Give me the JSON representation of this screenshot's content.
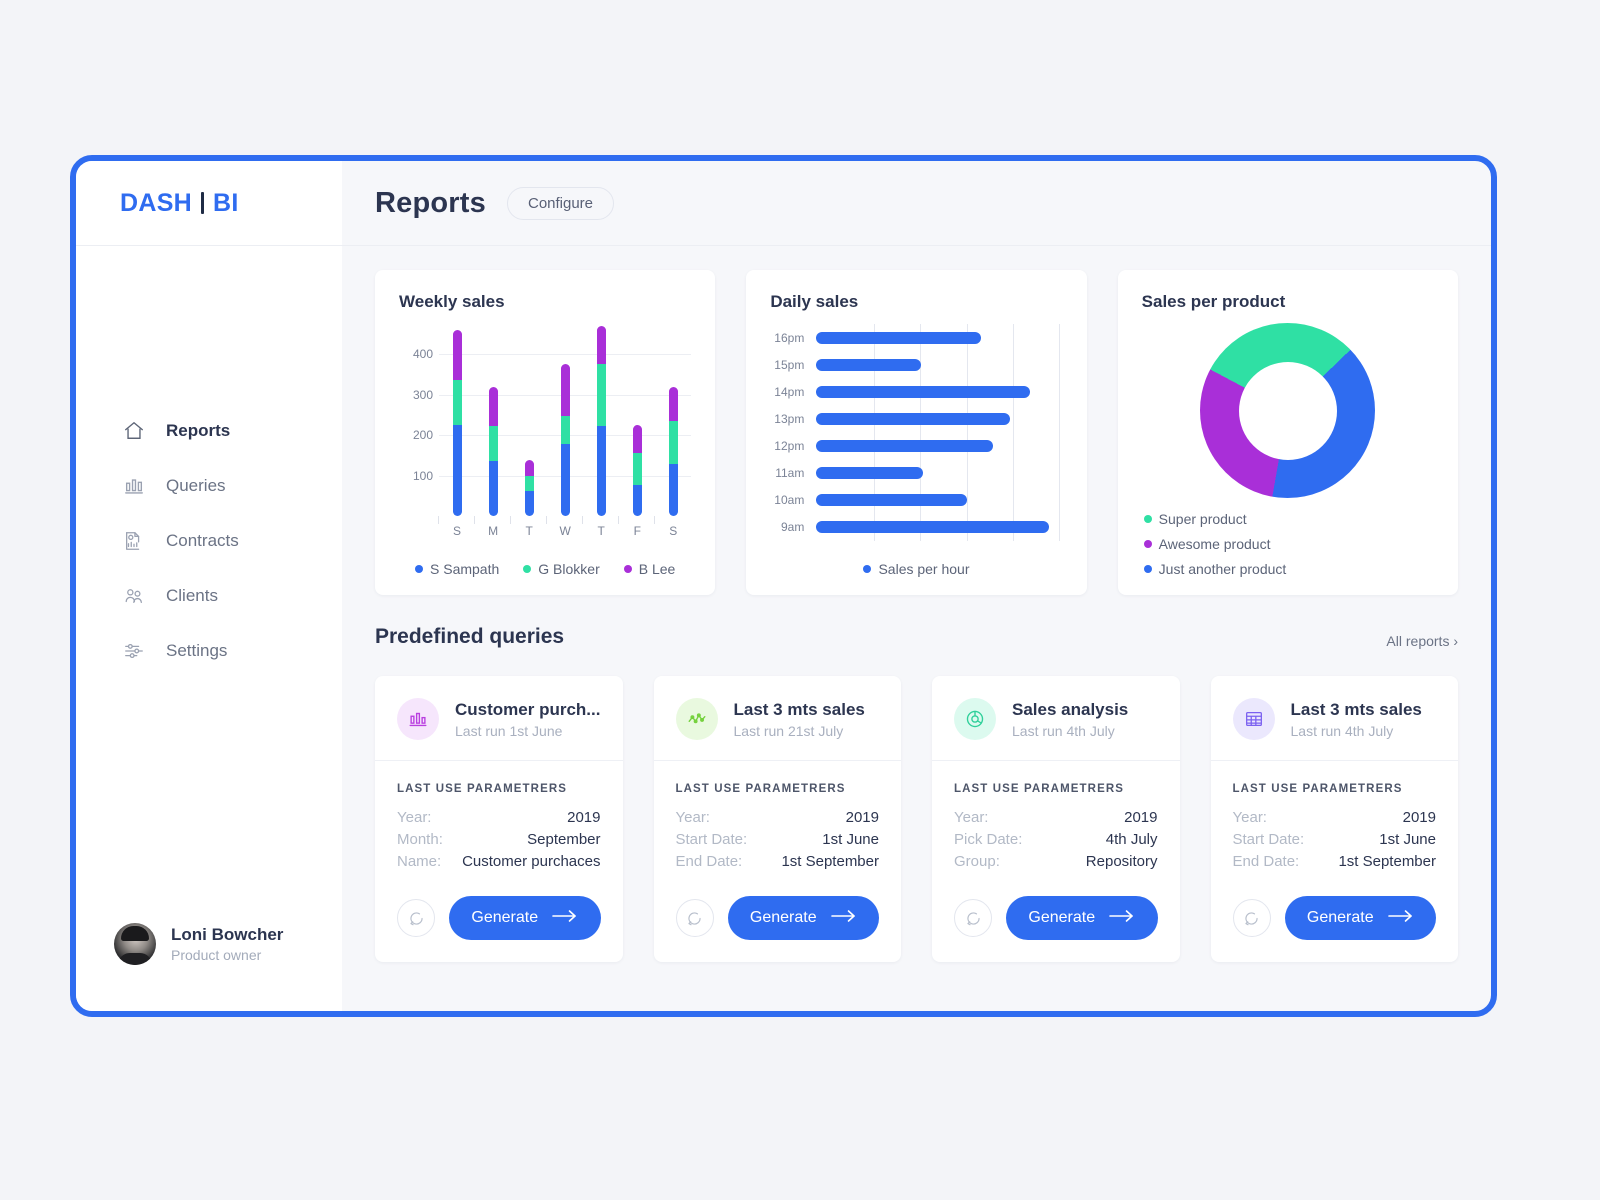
{
  "brand": {
    "part1": "DASH",
    "part2": "BI"
  },
  "sidebar": {
    "items": [
      {
        "label": "Reports",
        "icon": "home-icon",
        "active": true
      },
      {
        "label": "Queries",
        "icon": "bar-chart-icon",
        "active": false
      },
      {
        "label": "Contracts",
        "icon": "document-chart-icon",
        "active": false
      },
      {
        "label": "Clients",
        "icon": "users-icon",
        "active": false
      },
      {
        "label": "Settings",
        "icon": "sliders-icon",
        "active": false
      }
    ],
    "profile": {
      "name": "Loni Bowcher",
      "role": "Product owner"
    }
  },
  "header": {
    "title": "Reports",
    "configure_label": "Configure"
  },
  "colors": {
    "blue": "#2f6cf0",
    "green": "#2fe0a4",
    "purple": "#a92fd8",
    "text_dark": "#2c3550",
    "text_muted": "#7b8396"
  },
  "chart_data": [
    {
      "type": "bar",
      "title": "Weekly sales",
      "stacked": true,
      "categories": [
        "S",
        "M",
        "T",
        "W",
        "T",
        "F",
        "S"
      ],
      "series": [
        {
          "name": "S Sampath",
          "color": "#2f6cf0",
          "values": [
            225,
            135,
            62,
            178,
            227,
            76,
            129
          ]
        },
        {
          "name": "G Blokker",
          "color": "#2fe0a4",
          "values": [
            112,
            88,
            36,
            70,
            155,
            80,
            106
          ]
        },
        {
          "name": "B Lee",
          "color": "#a92fd8",
          "values": [
            123,
            96,
            41,
            128,
            95,
            70,
            84
          ]
        }
      ],
      "ylim": [
        0,
        470
      ],
      "yticks": [
        100,
        200,
        300,
        400
      ],
      "xlabel": "",
      "ylabel": "",
      "grid": true,
      "legend_position": "bottom"
    },
    {
      "type": "bar",
      "title": "Daily sales",
      "orientation": "horizontal",
      "categories": [
        "16pm",
        "15pm",
        "14pm",
        "13pm",
        "12pm",
        "11am",
        "10am",
        "9am"
      ],
      "series": [
        {
          "name": "Sales per hour",
          "color": "#2f6cf0",
          "values": [
            68,
            43,
            88,
            80,
            73,
            44,
            62,
            96
          ]
        }
      ],
      "xlim": [
        0,
        100
      ],
      "grid": true,
      "legend_position": "bottom"
    },
    {
      "type": "pie",
      "title": "Sales per product",
      "donut": true,
      "labels": [
        "Super product",
        "Awesome product",
        "Just another product"
      ],
      "values": [
        30,
        30,
        40
      ],
      "colors": [
        "#2fe0a4",
        "#a92fd8",
        "#2f6cf0"
      ],
      "legend_position": "bottom"
    }
  ],
  "queries_section": {
    "title": "Predefined queries",
    "all_reports_label": "All reports ›"
  },
  "query_cards": [
    {
      "name": "Customer purch...",
      "last_run": "Last run 1st June",
      "icon": "bar-chart-icon",
      "icon_color": "#b93fe0",
      "icon_bg": "#f6e6fc",
      "params_title": "LAST USE PARAMETRERS",
      "params": [
        {
          "key": "Year:",
          "value": "2019"
        },
        {
          "key": "Month:",
          "value": "September"
        },
        {
          "key": "Name:",
          "value": "Customer purchaces"
        }
      ],
      "refresh_label": "Refresh",
      "generate_label": "Generate"
    },
    {
      "name": "Last 3 mts sales",
      "last_run": "Last run 21st July",
      "icon": "line-chart-icon",
      "icon_color": "#74d13c",
      "icon_bg": "#e9f9df",
      "params_title": "LAST USE PARAMETRERS",
      "params": [
        {
          "key": "Year:",
          "value": "2019"
        },
        {
          "key": "Start Date:",
          "value": "1st June"
        },
        {
          "key": "End Date:",
          "value": "1st September"
        }
      ],
      "refresh_label": "Refresh",
      "generate_label": "Generate"
    },
    {
      "name": "Sales analysis",
      "last_run": "Last run 4th July",
      "icon": "donut-chart-icon",
      "icon_color": "#2fd09a",
      "icon_bg": "#dcfaef",
      "params_title": "LAST USE PARAMETRERS",
      "params": [
        {
          "key": "Year:",
          "value": "2019"
        },
        {
          "key": "Pick Date:",
          "value": "4th July"
        },
        {
          "key": "Group:",
          "value": "Repository"
        }
      ],
      "refresh_label": "Refresh",
      "generate_label": "Generate"
    },
    {
      "name": "Last 3 mts sales",
      "last_run": "Last run 4th July",
      "icon": "table-icon",
      "icon_color": "#7b61f0",
      "icon_bg": "#ebe8fd",
      "params_title": "LAST USE PARAMETRERS",
      "params": [
        {
          "key": "Year:",
          "value": "2019"
        },
        {
          "key": "Start Date:",
          "value": "1st June"
        },
        {
          "key": "End Date:",
          "value": "1st September"
        }
      ],
      "refresh_label": "Refresh",
      "generate_label": "Generate"
    }
  ]
}
